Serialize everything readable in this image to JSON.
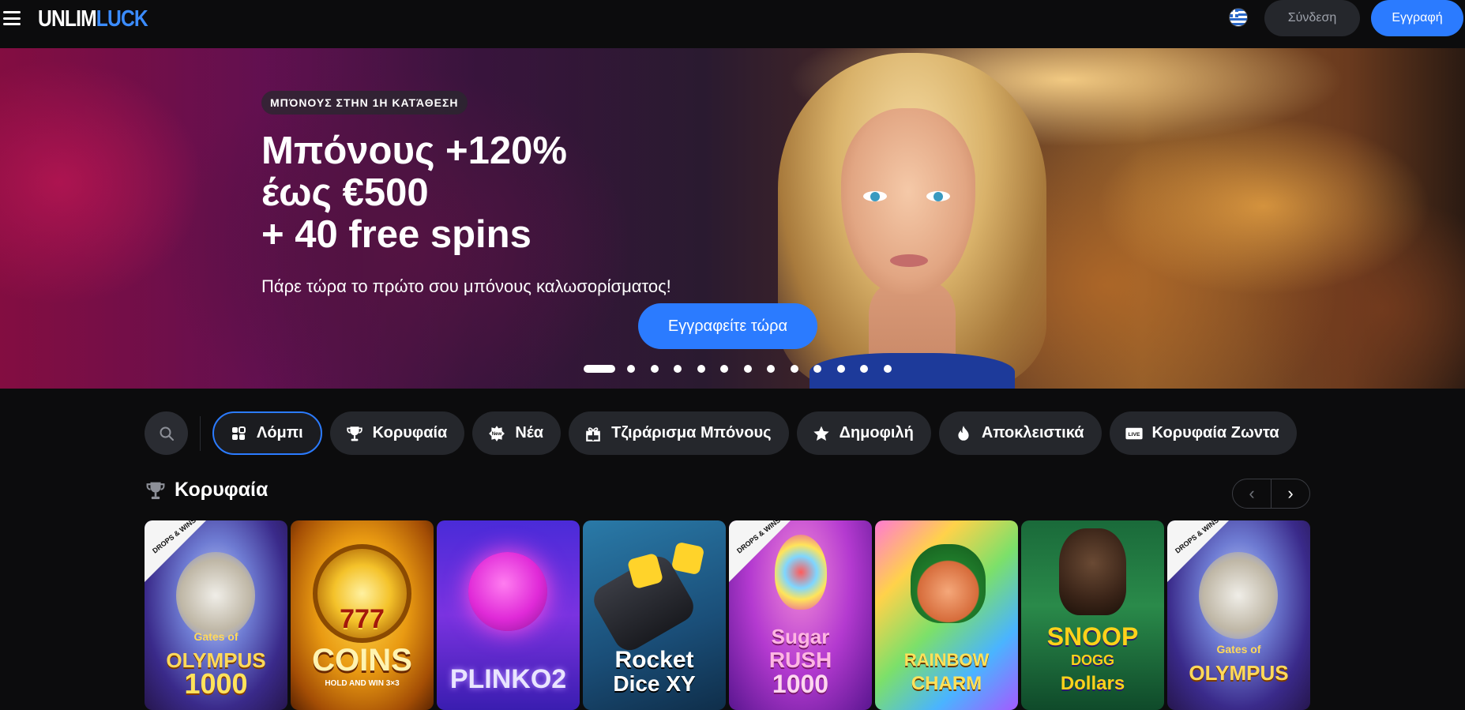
{
  "header": {
    "logo_part1": "UNLIM",
    "logo_part2": "LUCK",
    "login_label": "Σύνδεση",
    "register_label": "Εγγραφή"
  },
  "hero": {
    "badge": "ΜΠΌΝΟΥΣ ΣΤΗΝ 1Η ΚΑΤΆΘΕΣΗ",
    "title_lines": [
      "Μπόνους +120%",
      "έως €500",
      "+ 40 free spins"
    ],
    "subtitle": "Πάρε τώρα το πρώτο σου μπόνους καλωσορίσματος!",
    "cta": "Εγγραφείτε τώρα",
    "slide_count": 13,
    "active_slide": 1
  },
  "categories": [
    {
      "label": "Λόμπι",
      "icon": "grid-icon",
      "active": true
    },
    {
      "label": "Κορυφαία",
      "icon": "trophy-icon",
      "active": false
    },
    {
      "label": "Νέα",
      "icon": "new-badge-icon",
      "active": false
    },
    {
      "label": "Τζιράρισμα Μπόνους",
      "icon": "gift-icon",
      "active": false
    },
    {
      "label": "Δημοφιλή",
      "icon": "star-icon",
      "active": false
    },
    {
      "label": "Αποκλειστικά",
      "icon": "fire-icon",
      "active": false
    },
    {
      "label": "Κορυφαία Ζωντα",
      "icon": "live-icon",
      "active": false
    }
  ],
  "section": {
    "title": "Κορυφαία",
    "icon": "trophy-icon"
  },
  "games": [
    {
      "name": "Gates of Olympus 1000",
      "title_lines": [
        "Gates of",
        "OLYMPUS",
        "1000"
      ],
      "badge": "DROPS & WINS"
    },
    {
      "name": "Coins Hold and Win",
      "title_lines": [
        "777",
        "COINS",
        "HOLD AND WIN 3×3"
      ],
      "badge": ""
    },
    {
      "name": "Plinko 2",
      "title_lines": [
        "PLINKO2"
      ],
      "badge": ""
    },
    {
      "name": "Rocket Dice XY",
      "title_lines": [
        "Rocket",
        "Dice XY"
      ],
      "badge": ""
    },
    {
      "name": "Sugar Rush 1000",
      "title_lines": [
        "Sugar",
        "RUSH",
        "1000"
      ],
      "badge": "DROPS & WINS"
    },
    {
      "name": "Rainbow Charm",
      "title_lines": [
        "RAINBOW",
        "CHARM"
      ],
      "badge": ""
    },
    {
      "name": "Snoop Dogg Dollars",
      "title_lines": [
        "SNOOP",
        "DOGG",
        "Dollars"
      ],
      "badge": ""
    },
    {
      "name": "Gates of Olympus",
      "title_lines": [
        "Gates of",
        "OLYMPUS"
      ],
      "badge": "DROPS & WINS"
    }
  ],
  "colors": {
    "accent": "#2b7bff",
    "background": "#0c0c0d",
    "chip": "#25272c"
  }
}
